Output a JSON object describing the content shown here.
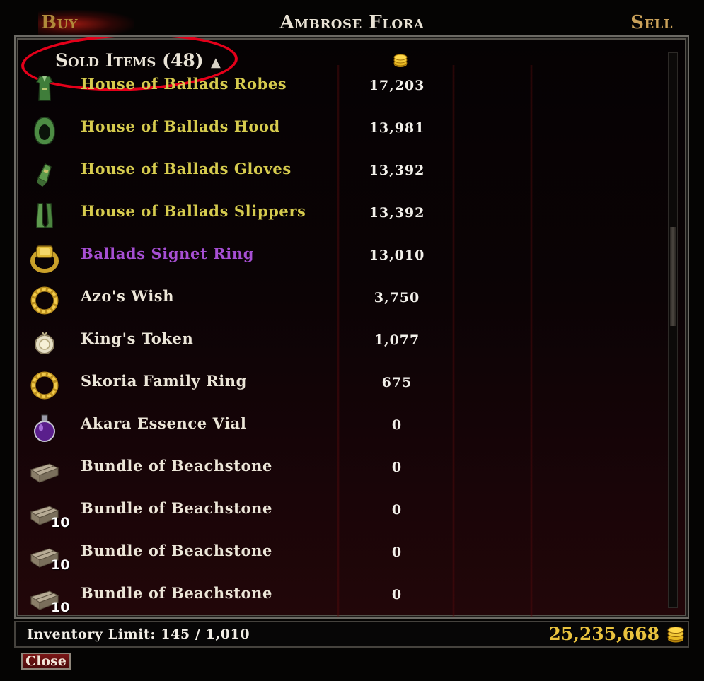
{
  "header": {
    "buy_tab": "Buy",
    "title": "Ambrose Flora",
    "sell_tab": "Sell"
  },
  "list_header": {
    "sold_label": "Sold Items (48)",
    "price_icon": "gold-coins-icon",
    "sort_icon": "sort-arrow-icon"
  },
  "items": [
    {
      "name": "House of Ballads Robes",
      "price": "17,203",
      "icon": "robe-icon",
      "quality": "set",
      "qty": ""
    },
    {
      "name": "House of Ballads Hood",
      "price": "13,981",
      "icon": "hood-icon",
      "quality": "set",
      "qty": ""
    },
    {
      "name": "House of Ballads Gloves",
      "price": "13,392",
      "icon": "gloves-icon",
      "quality": "set",
      "qty": ""
    },
    {
      "name": "House of Ballads Slippers",
      "price": "13,392",
      "icon": "slippers-icon",
      "quality": "set",
      "qty": ""
    },
    {
      "name": "Ballads Signet Ring",
      "price": "13,010",
      "icon": "signet-ring-icon",
      "quality": "magic",
      "qty": ""
    },
    {
      "name": "Azo's Wish",
      "price": "3,750",
      "icon": "gold-ring-icon",
      "quality": "normal",
      "qty": ""
    },
    {
      "name": "King's Token",
      "price": "1,077",
      "icon": "token-icon",
      "quality": "normal",
      "qty": ""
    },
    {
      "name": "Skoria Family Ring",
      "price": "675",
      "icon": "gold-ring-icon",
      "quality": "normal",
      "qty": ""
    },
    {
      "name": "Akara Essence Vial",
      "price": "0",
      "icon": "vial-icon",
      "quality": "normal",
      "qty": ""
    },
    {
      "name": "Bundle of Beachstone",
      "price": "0",
      "icon": "stone-bundle-icon",
      "quality": "normal",
      "qty": ""
    },
    {
      "name": "Bundle of Beachstone",
      "price": "0",
      "icon": "stone-bundle-icon",
      "quality": "normal",
      "qty": "10"
    },
    {
      "name": "Bundle of Beachstone",
      "price": "0",
      "icon": "stone-bundle-icon",
      "quality": "normal",
      "qty": "10"
    },
    {
      "name": "Bundle of Beachstone",
      "price": "0",
      "icon": "stone-bundle-icon",
      "quality": "normal",
      "qty": "10"
    }
  ],
  "footer": {
    "inventory_label": "Inventory Limit: 145 / 1,010",
    "gold": "25,235,668",
    "gold_icon": "gold-coins-icon",
    "close_label": "Close"
  },
  "colors": {
    "set_item": "#d6cb4e",
    "magic_item": "#a64fd3",
    "normal_item": "#ece6d8",
    "gold": "#e9c23e",
    "annotation_circle": "#e4001a"
  }
}
